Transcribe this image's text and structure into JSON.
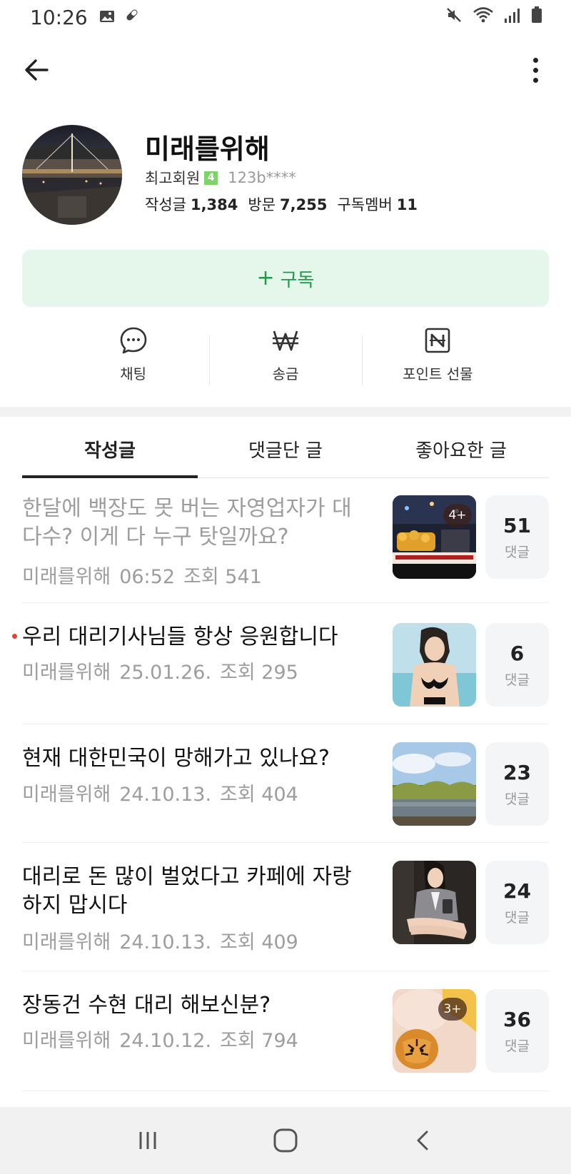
{
  "status_bar": {
    "time": "10:26",
    "left_icons": [
      "image-icon",
      "pill-icon"
    ],
    "right_icons": [
      "mute-icon",
      "wifi-icon",
      "signal-icon",
      "battery-icon"
    ]
  },
  "app_bar": {
    "back_icon": "arrow-left-icon",
    "more_icon": "more-vertical-icon"
  },
  "profile": {
    "nickname": "미래를위해",
    "grade": "최고회원",
    "grade_badge": "4",
    "member_id": "123b****",
    "stats": [
      {
        "label": "작성글",
        "value": "1,384"
      },
      {
        "label": "방문",
        "value": "7,255"
      },
      {
        "label": "구독멤버",
        "value": "11"
      }
    ]
  },
  "subscribe": {
    "plus": "+",
    "label": "구독",
    "color": "#1e9a4a",
    "background": "#e4f7ea"
  },
  "actions": [
    {
      "label": "채팅",
      "icon": "chat-bubble-icon"
    },
    {
      "label": "송금",
      "icon": "won-icon"
    },
    {
      "label": "포인트 선물",
      "icon": "npoint-icon"
    }
  ],
  "tabs": [
    {
      "label": "작성글",
      "active": true
    },
    {
      "label": "댓글단 글",
      "active": false
    },
    {
      "label": "좋아요한 글",
      "active": false
    }
  ],
  "posts": [
    {
      "title": "한달에 백장도 못 버는 자영업자가 대다수? 이게 다 누구 탓일까요?",
      "author": "미래를위해",
      "date": "06:52",
      "views": "조회 541",
      "read": true,
      "new": false,
      "thumb_badge": "4+",
      "comments": "51",
      "comment_label": "댓글"
    },
    {
      "title": "우리 대리기사님들 항상 응원합니다",
      "author": "미래를위해",
      "date": "25.01.26.",
      "views": "조회 295",
      "read": false,
      "new": true,
      "thumb_badge": "",
      "comments": "6",
      "comment_label": "댓글"
    },
    {
      "title": "현재 대한민국이 망해가고 있나요?",
      "author": "미래를위해",
      "date": "24.10.13.",
      "views": "조회 404",
      "read": false,
      "new": false,
      "thumb_badge": "",
      "comments": "23",
      "comment_label": "댓글"
    },
    {
      "title": "대리로 돈 많이 벌었다고 카페에 자랑하지 맙시다",
      "author": "미래를위해",
      "date": "24.10.13.",
      "views": "조회 409",
      "read": false,
      "new": false,
      "thumb_badge": "",
      "comments": "24",
      "comment_label": "댓글"
    },
    {
      "title": "장동건 수현 대리 해보신분?",
      "author": "미래를위해",
      "date": "24.10.12.",
      "views": "조회 794",
      "read": false,
      "new": false,
      "thumb_badge": "3+",
      "comments": "36",
      "comment_label": "댓글"
    }
  ],
  "nav_bar": {
    "icons": [
      "recent-apps-icon",
      "home-icon",
      "back-icon"
    ]
  }
}
